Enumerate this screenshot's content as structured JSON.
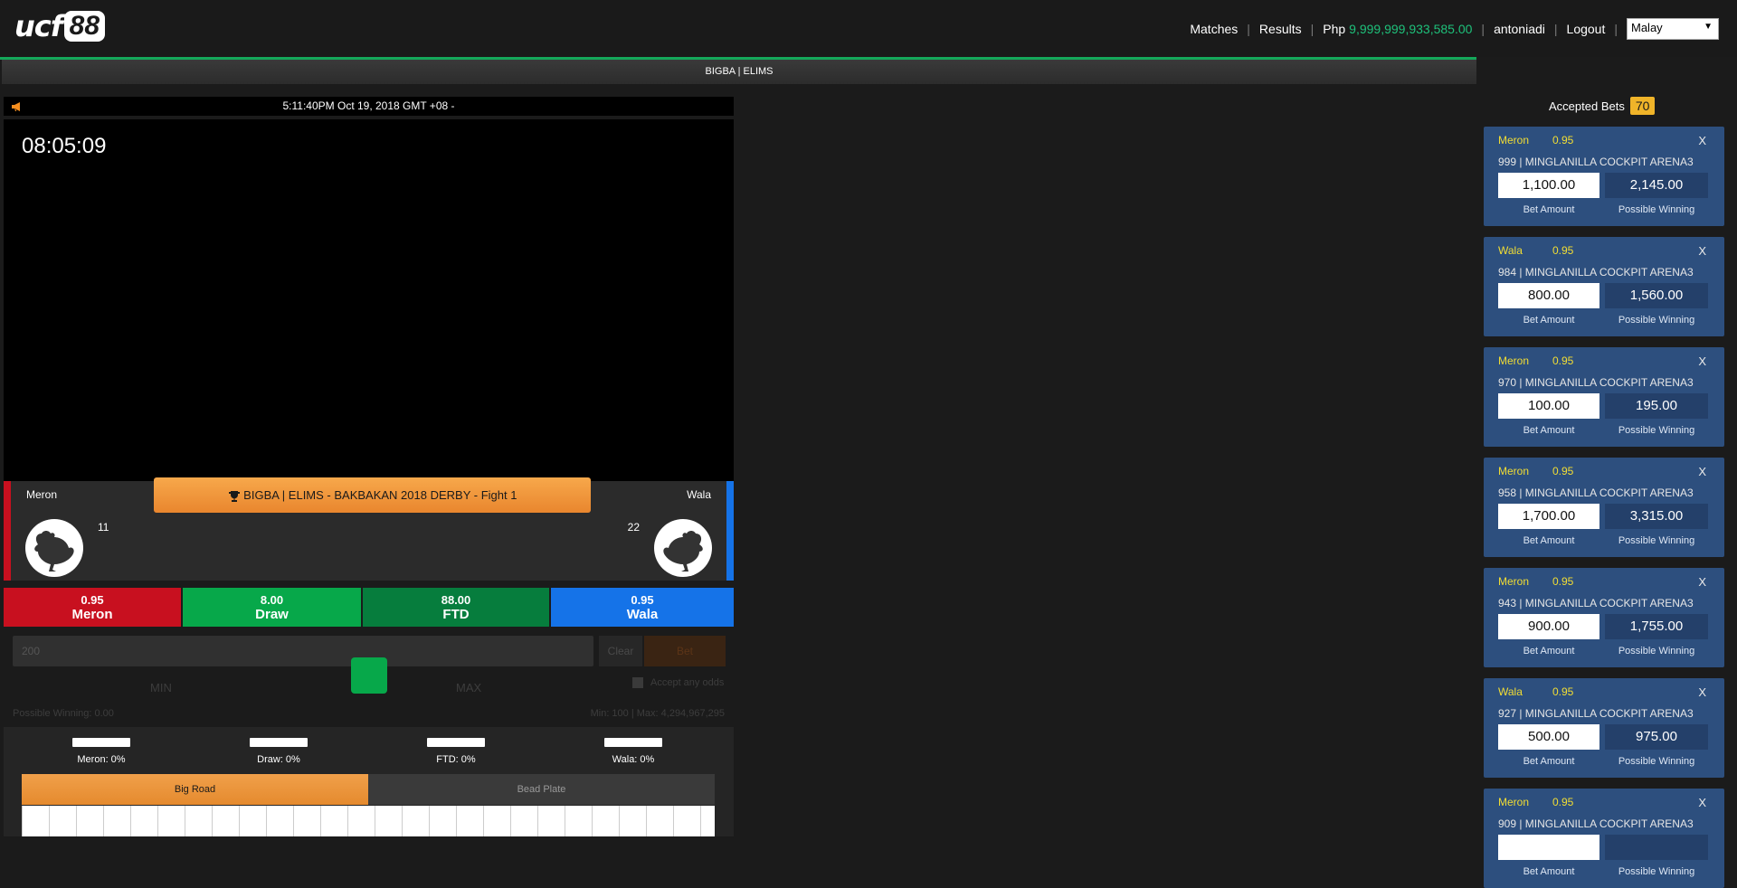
{
  "header": {
    "logo": "ucf88",
    "nav": {
      "matches": "Matches",
      "results": "Results",
      "currency": "Php",
      "balance": "9,999,999,933,585.00",
      "username": "antoniadi",
      "logout": "Logout",
      "language": "Malay"
    }
  },
  "match_title": "BIGBA | ELIMS",
  "time_bar": "5:11:40PM Oct 19, 2018 GMT +08 -",
  "video": {
    "timer": "08:05:09"
  },
  "fight": {
    "banner": "BIGBA | ELIMS - BAKBAKAN 2018 DERBY - Fight 1",
    "left": {
      "name": "Meron",
      "number": "11"
    },
    "right": {
      "name": "Wala",
      "number": "22"
    }
  },
  "odds": [
    {
      "value": "0.95",
      "label": "Meron",
      "color": "#c8101f"
    },
    {
      "value": "8.00",
      "label": "Draw",
      "color": "#07a84a"
    },
    {
      "value": "88.00",
      "label": "FTD",
      "color": "#067d3d"
    },
    {
      "value": "0.95",
      "label": "Wala",
      "color": "#1573e8"
    }
  ],
  "bet_panel": {
    "amount": "200",
    "clear": "Clear",
    "bet": "Bet",
    "min": "MIN",
    "max": "MAX",
    "accept_any_odds": "Accept any odds",
    "possible_winning": "Possible Winning: 0.00",
    "limits": "Min: 100 | Max: 4,294,967,295",
    "slider_level_percent": 50
  },
  "stats": [
    {
      "label": "Meron: 0%"
    },
    {
      "label": "Draw: 0%"
    },
    {
      "label": "FTD: 0%"
    },
    {
      "label": "Wala: 0%"
    }
  ],
  "road_tabs": {
    "big_road": "Big Road",
    "bead_plate": "Bead Plate"
  },
  "accepted_bets": {
    "title": "Accepted Bets",
    "count": "70",
    "bet_amount_label": "Bet Amount",
    "possible_winning_label": "Possible Winning",
    "items": [
      {
        "side": "Meron",
        "odds": "0.95",
        "arena": "999 | MINGLANILLA COCKPIT ARENA3",
        "amount": "1,100.00",
        "winning": "2,145.00"
      },
      {
        "side": "Wala",
        "odds": "0.95",
        "arena": "984 | MINGLANILLA COCKPIT ARENA3",
        "amount": "800.00",
        "winning": "1,560.00"
      },
      {
        "side": "Meron",
        "odds": "0.95",
        "arena": "970 | MINGLANILLA COCKPIT ARENA3",
        "amount": "100.00",
        "winning": "195.00"
      },
      {
        "side": "Meron",
        "odds": "0.95",
        "arena": "958 | MINGLANILLA COCKPIT ARENA3",
        "amount": "1,700.00",
        "winning": "3,315.00"
      },
      {
        "side": "Meron",
        "odds": "0.95",
        "arena": "943 | MINGLANILLA COCKPIT ARENA3",
        "amount": "900.00",
        "winning": "1,755.00"
      },
      {
        "side": "Wala",
        "odds": "0.95",
        "arena": "927 | MINGLANILLA COCKPIT ARENA3",
        "amount": "500.00",
        "winning": "975.00"
      },
      {
        "side": "Meron",
        "odds": "0.95",
        "arena": "909 | MINGLANILLA COCKPIT ARENA3",
        "amount": "",
        "winning": ""
      }
    ]
  }
}
